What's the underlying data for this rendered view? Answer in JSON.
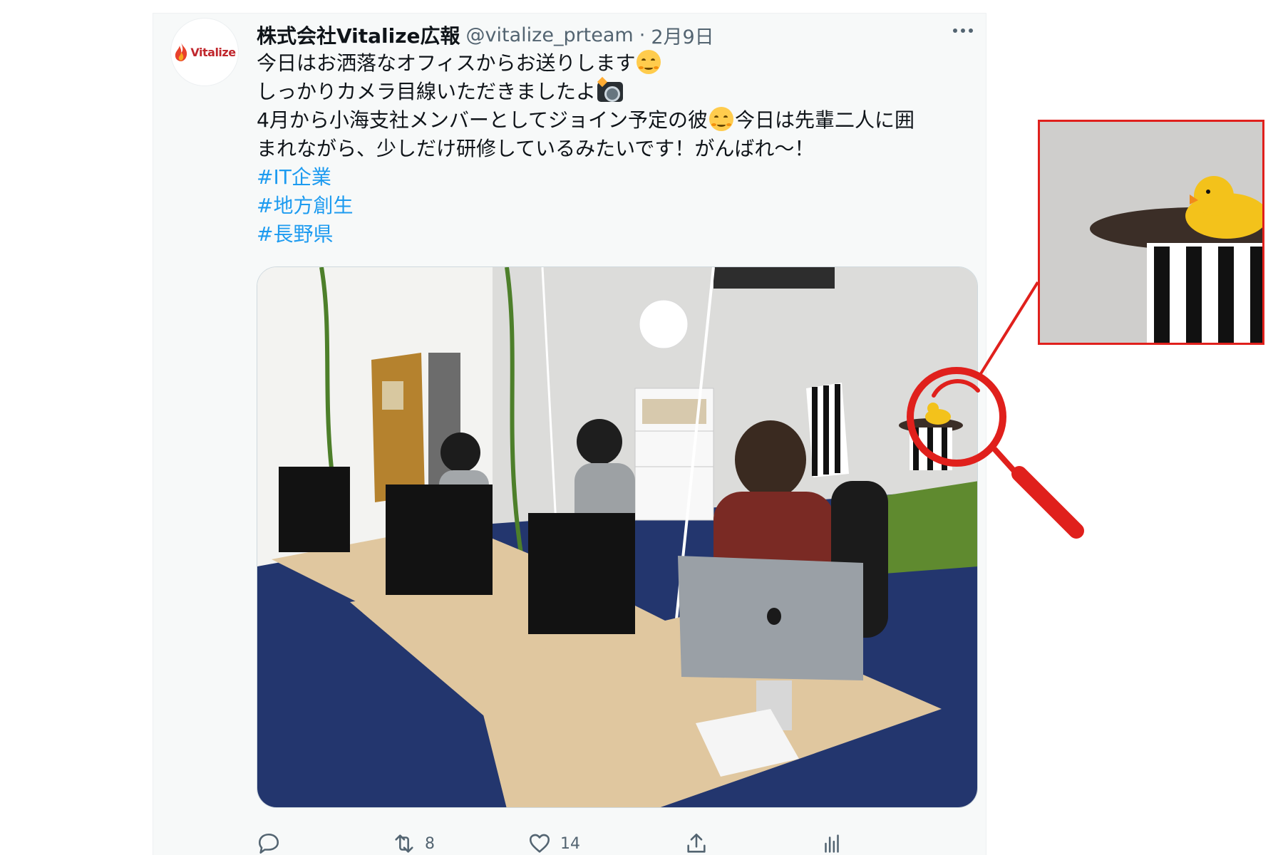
{
  "tweet": {
    "avatar": {
      "brand_text": "Vitalize",
      "brand_color": "#c0272d"
    },
    "display_name": "株式会社Vitalize広報",
    "handle": "@vitalize_prteam",
    "separator": "·",
    "date": "2月9日",
    "more_icon": "ellipsis-icon",
    "lines": [
      "今日はお洒落なオフィスからお送りします",
      "しっかりカメラ目線いただきましたよ",
      "4月から小海支社メンバーとしてジョイン予定の彼",
      "今日は先輩二人に囲",
      "まれながら、少しだけ研修しているみたいです！がんばれ〜！"
    ],
    "hashtags": [
      "#IT企業",
      "#地方創生",
      "#長野県"
    ],
    "hashtag_color": "#1d9bf0",
    "photo": {
      "description_icon": "office-photo"
    },
    "actions": {
      "reply": {
        "icon": "reply-icon"
      },
      "retweet": {
        "icon": "retweet-icon",
        "count": "8"
      },
      "like": {
        "icon": "heart-icon",
        "count": "14"
      },
      "share": {
        "icon": "share-icon"
      },
      "analytics": {
        "icon": "analytics-icon"
      }
    }
  },
  "annotation": {
    "magnifier_icon": "magnifier-icon",
    "highlight_color": "#e0201c",
    "zoom_subject": "rubber-duck"
  }
}
